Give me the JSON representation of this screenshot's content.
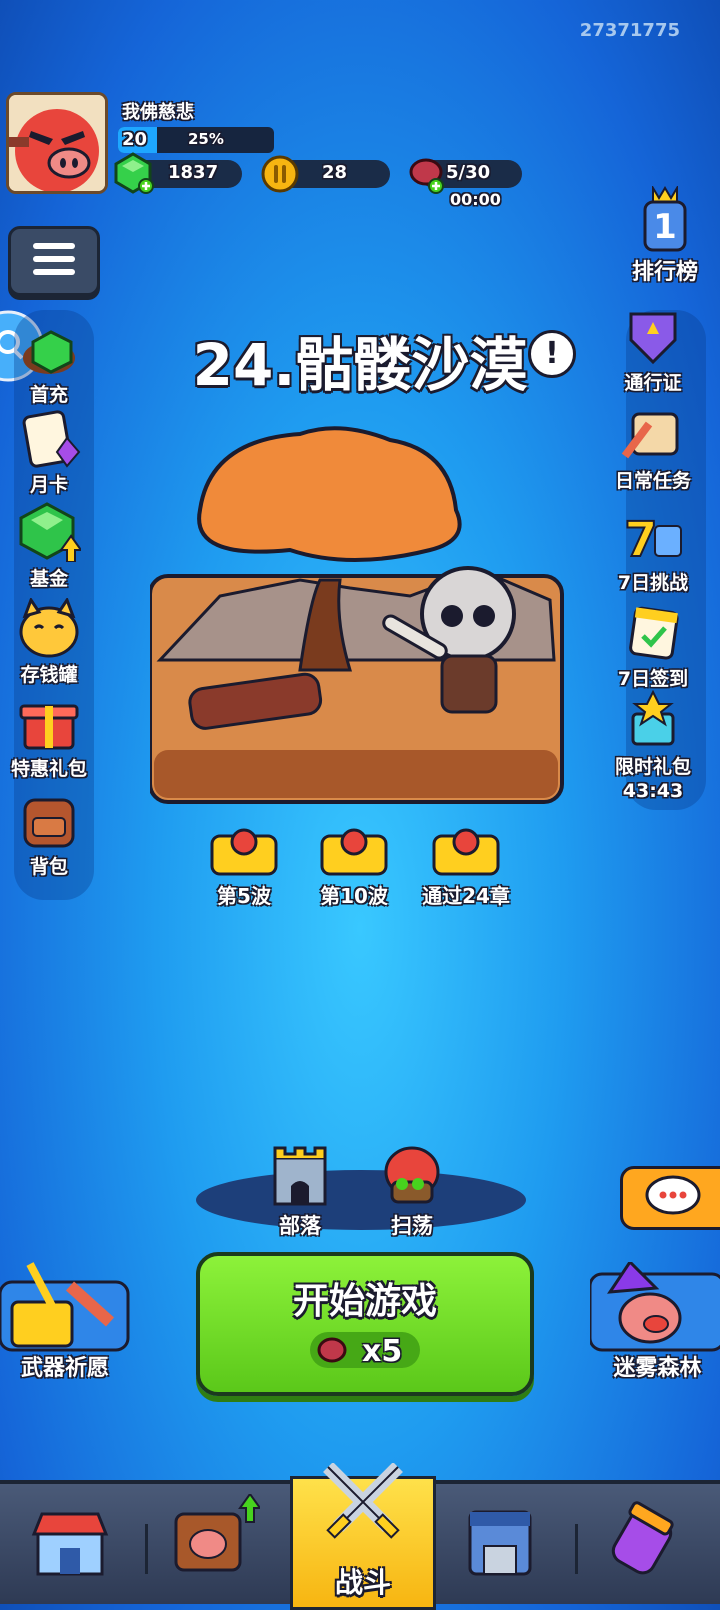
{
  "player": {
    "id_number": "27371775",
    "name": "我佛慈悲",
    "level": "20",
    "exp_percent": "25%",
    "exp_fraction": 0.25
  },
  "resources": {
    "gems": "1837",
    "coins": "28",
    "stamina": "5/30",
    "stamina_timer": "00:00"
  },
  "left_menu": [
    {
      "label": "首充",
      "icon": "gem-icon"
    },
    {
      "label": "月卡",
      "icon": "card-icon"
    },
    {
      "label": "基金",
      "icon": "fund-gem-icon"
    },
    {
      "label": "存钱罐",
      "icon": "lucky-cat-icon"
    },
    {
      "label": "特惠礼包",
      "icon": "gift-box-icon"
    },
    {
      "label": "背包",
      "icon": "backpack-icon"
    }
  ],
  "right_menu": [
    {
      "label": "排行榜",
      "icon": "trophy-icon"
    },
    {
      "label": "通行证",
      "icon": "badge-icon"
    },
    {
      "label": "日常任务",
      "icon": "scroll-icon"
    },
    {
      "label": "7日挑战",
      "icon": "seven-day-gift-icon"
    },
    {
      "label": "7日签到",
      "icon": "calendar-check-icon"
    },
    {
      "label": "限时礼包",
      "icon": "gift-icon",
      "timer": "43:43"
    }
  ],
  "stage": {
    "title": "24.骷髅沙漠",
    "info_icon": "!"
  },
  "rewards": [
    {
      "label": "第5波"
    },
    {
      "label": "第10波"
    },
    {
      "label": "通过24章"
    }
  ],
  "actions": {
    "tribe_label": "部落",
    "sweep_label": "扫荡",
    "start_label": "开始游戏",
    "start_cost": "x5",
    "weapon_wish_label": "武器祈愿",
    "misty_forest_label": "迷雾森林"
  },
  "nav": {
    "battle_label": "战斗",
    "tabs": [
      "shop-icon",
      "hero-book-icon",
      "battle-icon",
      "building-icon",
      "potion-icon"
    ]
  },
  "colors": {
    "accent_green": "#6fe028",
    "bg_blue": "#1f9cf0",
    "gold": "#f7b511"
  }
}
